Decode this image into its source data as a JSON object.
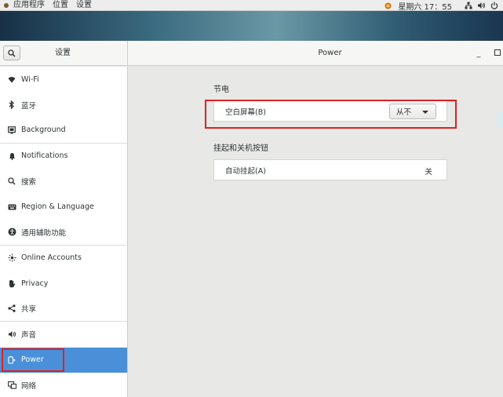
{
  "topbar": {
    "applications": "应用程序",
    "places": "位置",
    "settings": "设置",
    "clock": "星期六 17：55",
    "icons": [
      "apps-icon",
      "weather-icon",
      "network-icon",
      "volume-icon",
      "power-icon"
    ]
  },
  "header": {
    "settings_title": "设置",
    "panel_title": "Power",
    "minimize": "_"
  },
  "sidebar": {
    "items": [
      {
        "label": "Wi-Fi",
        "icon": "wifi-icon"
      },
      {
        "label": "蓝牙",
        "icon": "bluetooth-icon"
      },
      {
        "label": "Background",
        "icon": "background-icon"
      },
      {
        "label": "Notifications",
        "icon": "bell-icon"
      },
      {
        "label": "搜索",
        "icon": "search-icon"
      },
      {
        "label": "Region & Language",
        "icon": "keyboard-icon"
      },
      {
        "label": "通用辅助功能",
        "icon": "accessibility-icon"
      },
      {
        "label": "Online Accounts",
        "icon": "online-accounts-icon"
      },
      {
        "label": "Privacy",
        "icon": "hand-icon"
      },
      {
        "label": "共享",
        "icon": "share-icon"
      },
      {
        "label": "声音",
        "icon": "speaker-icon"
      },
      {
        "label": "Power",
        "icon": "power-plug-icon"
      },
      {
        "label": "网络",
        "icon": "network-icon"
      }
    ]
  },
  "content": {
    "power_saving": {
      "title": "节电",
      "blank_screen_label": "空白屏幕(B)",
      "blank_screen_value": "从不"
    },
    "suspend": {
      "title": "挂起和关机按钮",
      "auto_suspend_label": "自动挂起(A)",
      "auto_suspend_value": "关"
    }
  },
  "colors": {
    "accent": "#4a90d9",
    "highlight": "#e02020"
  }
}
